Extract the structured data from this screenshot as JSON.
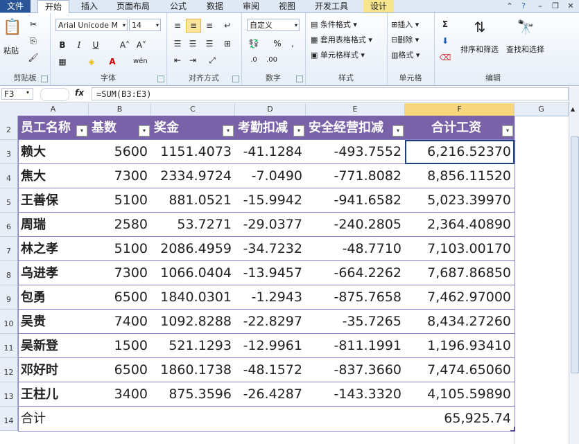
{
  "tabs": [
    "文件",
    "开始",
    "插入",
    "页面布局",
    "公式",
    "数据",
    "审阅",
    "视图",
    "开发工具",
    "设计"
  ],
  "active_tab": "开始",
  "ribbon": {
    "clipboard": {
      "label": "剪贴板",
      "paste": "粘贴"
    },
    "font": {
      "label": "字体",
      "name": "Arial Unicode M",
      "size": "14"
    },
    "alignment": {
      "label": "对齐方式"
    },
    "number": {
      "label": "数字",
      "format": "自定义"
    },
    "styles": {
      "label": "样式",
      "conditional": "条件格式",
      "table": "套用表格格式",
      "cell": "单元格样式"
    },
    "cells": {
      "label": "单元格",
      "insert": "插入",
      "delete": "删除",
      "format": "格式"
    },
    "editing": {
      "label": "编辑",
      "sort": "排序和筛选",
      "find": "查找和选择"
    }
  },
  "formula_bar": {
    "name_box": "F3",
    "fx": "fx",
    "formula": "=SUM(B3:E3)"
  },
  "columns": [
    "A",
    "B",
    "C",
    "D",
    "E",
    "F",
    "G"
  ],
  "table": {
    "headers": [
      "员工名称",
      "基数",
      "奖金",
      "考勤扣减",
      "安全经营扣减",
      "合计工资"
    ],
    "rows": [
      [
        "赖大",
        "5600",
        "1151.4073",
        "-41.1284",
        "-493.7552",
        "6,216.52370"
      ],
      [
        "焦大",
        "7300",
        "2334.9724",
        "-7.0490",
        "-771.8082",
        "8,856.11520"
      ],
      [
        "王善保",
        "5100",
        "881.0521",
        "-15.9942",
        "-941.6582",
        "5,023.39970"
      ],
      [
        "周瑞",
        "2580",
        "53.7271",
        "-29.0377",
        "-240.2805",
        "2,364.40890"
      ],
      [
        "林之孝",
        "5100",
        "2086.4959",
        "-34.7232",
        "-48.7710",
        "7,103.00170"
      ],
      [
        "乌进孝",
        "7300",
        "1066.0404",
        "-13.9457",
        "-664.2262",
        "7,687.86850"
      ],
      [
        "包勇",
        "6500",
        "1840.0301",
        "-1.2943",
        "-875.7658",
        "7,462.97000"
      ],
      [
        "吴贵",
        "7400",
        "1092.8288",
        "-22.8297",
        "-35.7265",
        "8,434.27260"
      ],
      [
        "吴新登",
        "1500",
        "521.1293",
        "-12.9961",
        "-811.1991",
        "1,196.93410"
      ],
      [
        "邓好时",
        "6500",
        "1860.1738",
        "-48.1572",
        "-837.3660",
        "7,474.65060"
      ],
      [
        "王柱儿",
        "3400",
        "875.3596",
        "-26.4287",
        "-143.3320",
        "4,105.59890"
      ]
    ],
    "total_label": "合计",
    "total_value": "65,925.74",
    "row_numbers": [
      "2",
      "3",
      "4",
      "5",
      "6",
      "7",
      "8",
      "9",
      "10",
      "11",
      "12",
      "13",
      "14"
    ]
  },
  "colors": {
    "header_bg": "#7a62a8",
    "accent": "#2a5699"
  }
}
